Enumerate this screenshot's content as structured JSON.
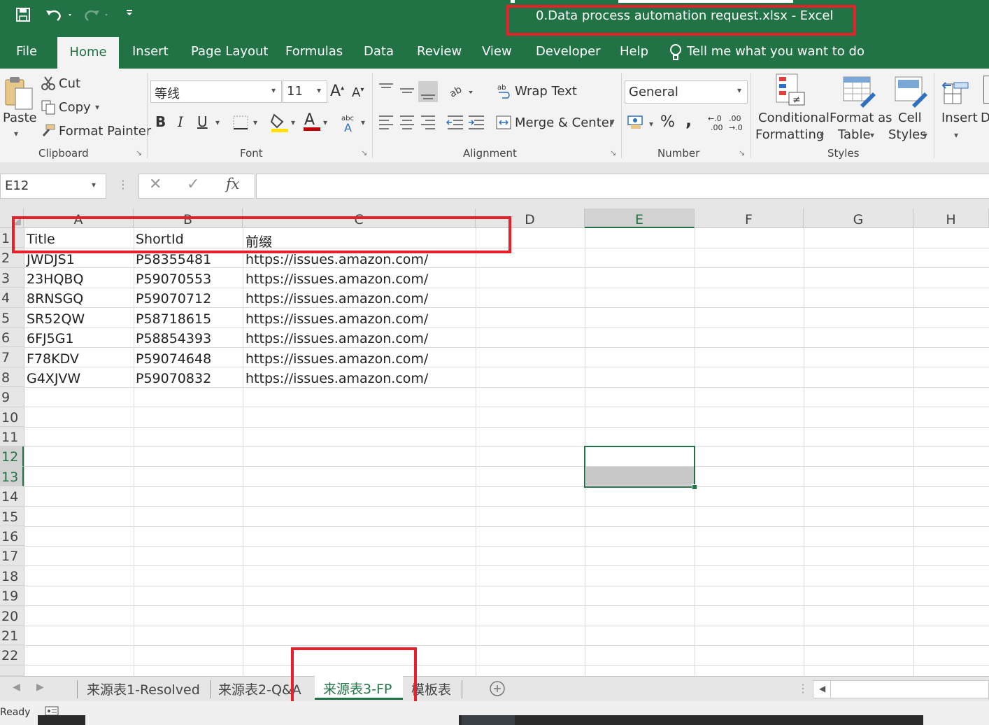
{
  "window": {
    "title": "0.Data process automation request.xlsx  -  Excel"
  },
  "menu": {
    "file": "File",
    "home": "Home",
    "insert": "Insert",
    "page_layout": "Page Layout",
    "formulas": "Formulas",
    "data": "Data",
    "review": "Review",
    "view": "View",
    "developer": "Developer",
    "help": "Help",
    "tell_me": "Tell me what you want to do"
  },
  "ribbon": {
    "clipboard": {
      "paste": "Paste",
      "cut": "Cut",
      "copy": "Copy",
      "format_painter": "Format Painter",
      "label": "Clipboard"
    },
    "font": {
      "font_name": "等线",
      "font_size": "11",
      "bold": "B",
      "italic": "I",
      "underline": "U",
      "label": "Font"
    },
    "alignment": {
      "wrap_text": "Wrap Text",
      "merge_center": "Merge & Center",
      "label": "Alignment"
    },
    "number": {
      "format": "General",
      "percent": "%",
      "comma": ",",
      "label": "Number"
    },
    "styles": {
      "conditional_1": "Conditional",
      "conditional_2": "Formatting",
      "format_table_1": "Format as",
      "format_table_2": "Table",
      "cell_styles_1": "Cell",
      "cell_styles_2": "Styles",
      "label": "Styles"
    },
    "cells": {
      "insert": "Insert",
      "delete_partial": "D"
    }
  },
  "formula_bar": {
    "name_box": "E12",
    "fx": "fx",
    "content": ""
  },
  "columns": [
    "A",
    "B",
    "C",
    "D",
    "E",
    "F",
    "G",
    "H"
  ],
  "rows": [
    "1",
    "2",
    "3",
    "4",
    "5",
    "6",
    "7",
    "8",
    "9",
    "10",
    "11",
    "12",
    "13",
    "14",
    "15",
    "16",
    "17",
    "18",
    "19",
    "20",
    "21",
    "22"
  ],
  "table": {
    "headers": [
      "Title",
      "ShortId",
      "前缀"
    ],
    "rows": [
      [
        "JWDJS1",
        "P58355481",
        "https://issues.amazon.com/"
      ],
      [
        "23HQBQ",
        "P59070553",
        "https://issues.amazon.com/"
      ],
      [
        "8RNSGQ",
        "P59070712",
        "https://issues.amazon.com/"
      ],
      [
        "SR52QW",
        "P58718615",
        "https://issues.amazon.com/"
      ],
      [
        "6FJ5G1",
        "P58854393",
        "https://issues.amazon.com/"
      ],
      [
        "F78KDV",
        "P59074648",
        "https://issues.amazon.com/"
      ],
      [
        "G4XJVW",
        "P59070832",
        "https://issues.amazon.com/"
      ]
    ]
  },
  "sheets": {
    "tab1": "来源表1-Resolved",
    "tab2": "来源表2-Q&A",
    "tab3": "来源表3-FP",
    "tab4": "模板表"
  },
  "status": {
    "ready": "Ready"
  },
  "colors": {
    "excel_green": "#217346",
    "highlight_red": "#e8202a"
  }
}
